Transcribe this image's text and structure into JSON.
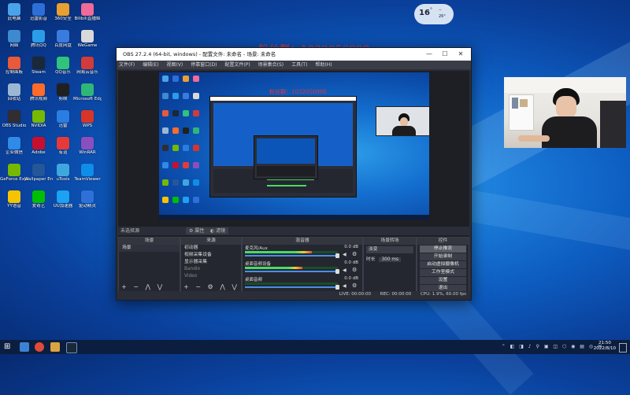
{
  "desktop": {
    "icons": [
      {
        "label": "此电脑",
        "color": "#4aa3e8"
      },
      {
        "label": "迅雷影音",
        "color": "#2d6fd8"
      },
      {
        "label": "360安全",
        "color": "#e8a030"
      },
      {
        "label": "Bilibili直播姬",
        "color": "#f06a9a"
      },
      {
        "label": "网络",
        "color": "#3d8ad0"
      },
      {
        "label": "腾讯QQ",
        "color": "#2b9ce8"
      },
      {
        "label": "百度网盘",
        "color": "#3a7be0"
      },
      {
        "label": "WeGame",
        "color": "#d9d9d9"
      },
      {
        "label": "控制面板",
        "color": "#e85a3a"
      },
      {
        "label": "Steam",
        "color": "#1b2838"
      },
      {
        "label": "QQ音乐",
        "color": "#31c27c"
      },
      {
        "label": "网易云音乐",
        "color": "#d13b3b"
      },
      {
        "label": "回收站",
        "color": "#9bb7d4"
      },
      {
        "label": "腾讯视频",
        "color": "#ff6b2b"
      },
      {
        "label": "剪映",
        "color": "#202020"
      },
      {
        "label": "Microsoft Edge",
        "color": "#2fb77a"
      },
      {
        "label": "OBS Studio",
        "color": "#302e31"
      },
      {
        "label": "NVIDIA",
        "color": "#76b900"
      },
      {
        "label": "迅雷",
        "color": "#2a7de1"
      },
      {
        "label": "WPS",
        "color": "#d8352a"
      },
      {
        "label": "企业微信",
        "color": "#2f8ae8"
      },
      {
        "label": "Adobe",
        "color": "#c8102e"
      },
      {
        "label": "有道",
        "color": "#e63a3a"
      },
      {
        "label": "WinRAR",
        "color": "#8a4fbf"
      },
      {
        "label": "GeForce Experience",
        "color": "#76b900"
      },
      {
        "label": "Wallpaper Engine",
        "color": "#24579a"
      },
      {
        "label": "uTools",
        "color": "#3fa7e0"
      },
      {
        "label": "TeamViewer",
        "color": "#0e8ee9"
      },
      {
        "label": "YY语音",
        "color": "#f5c400"
      },
      {
        "label": "爱奇艺",
        "color": "#00be06"
      },
      {
        "label": "UU加速器",
        "color": "#1da1f2"
      },
      {
        "label": "驱动精灵",
        "color": "#2f70d8"
      }
    ]
  },
  "widget": {
    "temp": "16",
    "unit": "°",
    "line1": "--",
    "line2": "26°"
  },
  "watermark": {
    "main": "粉丝群：1032056998",
    "small": "粉丝群：1032056998"
  },
  "obs": {
    "title": "OBS 27.2.4 (64-bit, windows) - 配置文件: 未命名 - 场景: 未命名",
    "menu": [
      "文件(F)",
      "编辑(E)",
      "视图(V)",
      "停靠窗口(D)",
      "配置文件(P)",
      "场景集合(S)",
      "工具(T)",
      "帮助(H)"
    ],
    "no_source_label": "未选择源",
    "props_btn": "属性",
    "filter_btn": "滤镜",
    "scenes": {
      "header": "场景",
      "items": [
        "场景"
      ]
    },
    "sources": {
      "header": "来源",
      "items": [
        "初动器",
        "视频采集设备",
        "显示器采集",
        "Bandlo",
        "Video"
      ]
    },
    "mixer": {
      "header": "混音器",
      "channels": [
        {
          "name": "麦克风/Aux",
          "db": "0.0 dB",
          "level": 0.72
        },
        {
          "name": "桌面音频设备",
          "db": "0.0 dB",
          "level": 0.62
        },
        {
          "name": "桌面音频",
          "db": "0.0 dB",
          "level": 0.0
        }
      ]
    },
    "transitions": {
      "header": "场景转场",
      "type": "淡变",
      "duration_label": "时长",
      "duration": "300 ms"
    },
    "controls": {
      "header": "控件",
      "buttons": [
        "停止推流",
        "开始录制",
        "启动虚拟摄像机",
        "工作室模式",
        "设置",
        "退出"
      ]
    },
    "status": {
      "live": "LIVE: 00:00:00",
      "rec": "REC: 00:00:00",
      "cpu": "CPU: 1.9%, 60.00 fps"
    }
  },
  "taskbar": {
    "time": "21:50",
    "date": "2022/8/10"
  }
}
